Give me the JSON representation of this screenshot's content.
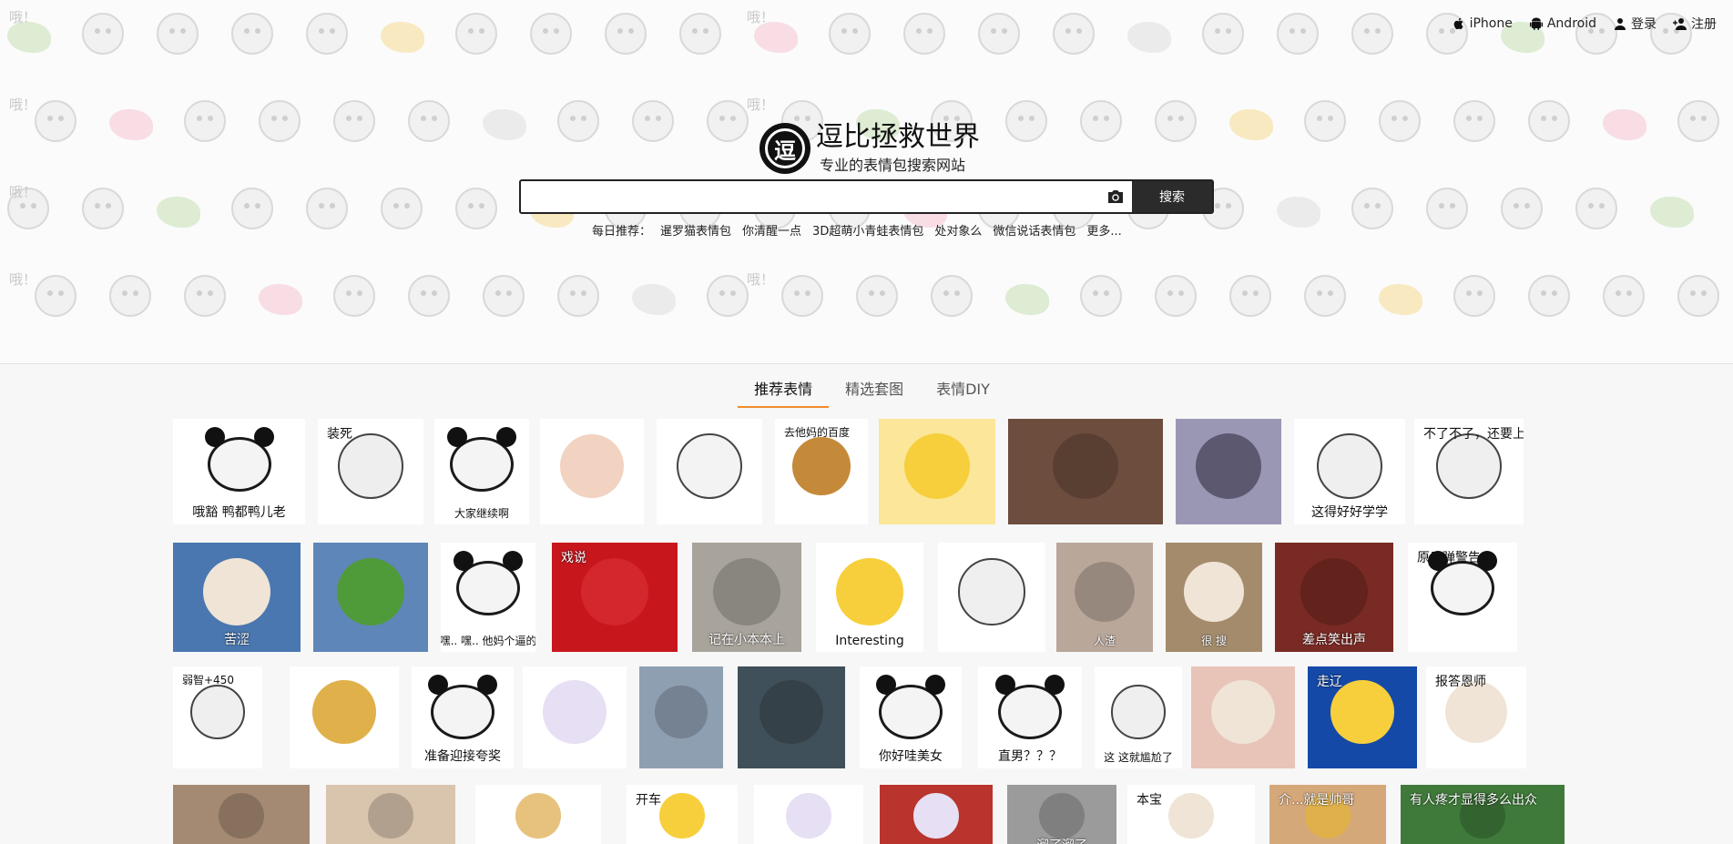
{
  "topnav": {
    "iphone": "iPhone",
    "android": "Android",
    "login": "登录",
    "register": "注册"
  },
  "brand": {
    "logo_glyph": "逗",
    "title": "逗比拯救世界",
    "subtitle": "专业的表情包搜索网站"
  },
  "search": {
    "placeholder": "",
    "button_label": "搜索"
  },
  "daily": {
    "label": "每日推荐：",
    "items": [
      "暹罗猫表情包",
      "你清醒一点",
      "3D超萌小青蛙表情包",
      "处对象么",
      "微信说话表情包",
      "更多..."
    ]
  },
  "tabs": [
    "推荐表情",
    "精选套图",
    "表情DIY"
  ],
  "pattern_labels": [
    "哦！",
    "哦！",
    "哦！",
    "哦！",
    "哦！",
    "哦！",
    "哦！",
    "哦！"
  ],
  "colors": {
    "accent": "#f08c2e",
    "search_button": "#2b2b2b",
    "text": "#222222"
  },
  "tiles": [
    {
      "caption": "哦豁  鸭都鸭儿老",
      "bg": "#ffffff",
      "style": "dark",
      "kind": "panda"
    },
    {
      "caption": "装死",
      "bg": "#ffffff",
      "style": "dark-top",
      "kind": "blob"
    },
    {
      "caption": "大家继续啊",
      "bg": "#ffffff",
      "style": "dark",
      "kind": "panda"
    },
    {
      "caption": "",
      "bg": "#ffffff",
      "style": "dark",
      "kind": "girl"
    },
    {
      "caption": "",
      "bg": "#ffffff",
      "style": "dark",
      "kind": "line"
    },
    {
      "caption": "去他妈的百度",
      "bg": "#ffffff",
      "style": "dark-top",
      "kind": "bear"
    },
    {
      "caption": "",
      "bg": "#fbe69a",
      "style": "dark",
      "kind": "chick"
    },
    {
      "caption": "",
      "bg": "#6d4d3e",
      "style": "light",
      "kind": "photo"
    },
    {
      "caption": "",
      "bg": "#9a97b5",
      "style": "light",
      "kind": "pigeon"
    },
    {
      "caption": "这得好好学学",
      "bg": "#ffffff",
      "style": "dark",
      "kind": "sketch"
    },
    {
      "caption": "不了不了，还要上课呢",
      "bg": "#ffffff",
      "style": "dark-top",
      "kind": "sketch"
    },
    {
      "caption": "苦涩",
      "bg": "#4a77b0",
      "style": "light",
      "kind": "cat"
    },
    {
      "caption": "",
      "bg": "#5f86b8",
      "style": "light",
      "kind": "frog"
    },
    {
      "caption": "嘿.. 嘿.. 他妈个逼的",
      "bg": "#ffffff",
      "style": "dark",
      "kind": "panda"
    },
    {
      "caption": "戏说",
      "bg": "#c8161d",
      "style": "light-top",
      "kind": "poster"
    },
    {
      "caption": "记在小本本上",
      "bg": "#a8a39b",
      "style": "light",
      "kind": "photo"
    },
    {
      "caption": "Interesting",
      "bg": "#ffffff",
      "style": "dark",
      "kind": "chick"
    },
    {
      "caption": "",
      "bg": "#ffffff",
      "style": "dark",
      "kind": "sketch"
    },
    {
      "caption": "人渣",
      "bg": "#b9a79a",
      "style": "light",
      "kind": "photo"
    },
    {
      "caption": "很        搜",
      "bg": "#a38b6c",
      "style": "light",
      "kind": "cat"
    },
    {
      "caption": "差点笑出声",
      "bg": "#7a2a24",
      "style": "light",
      "kind": "photo"
    },
    {
      "caption": "原子弹警告",
      "bg": "#ffffff",
      "style": "dark-top",
      "kind": "panda"
    },
    {
      "caption": "弱智+450",
      "bg": "#ffffff",
      "style": "dark-top",
      "kind": "sketch"
    },
    {
      "caption": "",
      "bg": "#ffffff",
      "style": "dark",
      "kind": "doge"
    },
    {
      "caption": "准备迎接夸奖",
      "bg": "#ffffff",
      "style": "dark",
      "kind": "panda"
    },
    {
      "caption": "",
      "bg": "#ffffff",
      "style": "dark",
      "kind": "anime"
    },
    {
      "caption": "",
      "bg": "#8e9fb2",
      "style": "light",
      "kind": "photo"
    },
    {
      "caption": "",
      "bg": "#40505a",
      "style": "light",
      "kind": "photo"
    },
    {
      "caption": "你好哇美女",
      "bg": "#ffffff",
      "style": "dark",
      "kind": "panda"
    },
    {
      "caption": "直男？？？",
      "bg": "#ffffff",
      "style": "dark",
      "kind": "panda"
    },
    {
      "caption": "这 这就尴尬了",
      "bg": "#ffffff",
      "style": "dark",
      "kind": "sketch"
    },
    {
      "caption": "",
      "bg": "#e8c3b8",
      "style": "light",
      "kind": "cat"
    },
    {
      "caption": "走辽",
      "bg": "#1549a8",
      "style": "light-top",
      "kind": "chick"
    },
    {
      "caption": "报答恩师",
      "bg": "#ffffff",
      "style": "dark-top",
      "kind": "cat"
    },
    {
      "caption": "",
      "bg": "#a58a73",
      "style": "light",
      "kind": "photo"
    },
    {
      "caption": "",
      "bg": "#d9c4ae",
      "style": "light",
      "kind": "photo"
    },
    {
      "caption": "",
      "bg": "#ffffff",
      "style": "dark",
      "kind": "tiger"
    },
    {
      "caption": "开车",
      "bg": "#ffffff",
      "style": "dark-top",
      "kind": "chick"
    },
    {
      "caption": "",
      "bg": "#ffffff",
      "style": "dark",
      "kind": "anime"
    },
    {
      "caption": "",
      "bg": "#b8342d",
      "style": "light",
      "kind": "anime"
    },
    {
      "caption": "溜了溜了",
      "bg": "#9b9b9b",
      "style": "light",
      "kind": "photo"
    },
    {
      "caption": "本宝",
      "bg": "#ffffff",
      "style": "dark-top",
      "kind": "cat"
    },
    {
      "caption": "介...就是帅哥",
      "bg": "#d5a87a",
      "style": "light-top",
      "kind": "doge"
    },
    {
      "caption": "有人疼才显得多么出众",
      "bg": "#3f7a3a",
      "style": "light-top",
      "kind": "photo"
    }
  ]
}
